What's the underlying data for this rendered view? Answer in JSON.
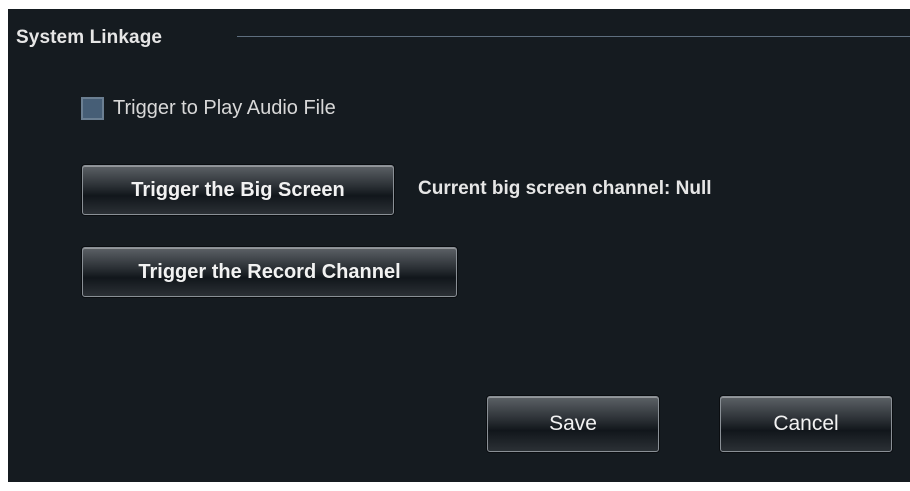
{
  "section": {
    "title": "System Linkage"
  },
  "audio_checkbox": {
    "label": "Trigger to Play Audio File",
    "checked": false
  },
  "buttons": {
    "big_screen": "Trigger the Big Screen",
    "record_channel": "Trigger the Record Channel",
    "save": "Save",
    "cancel": "Cancel"
  },
  "status": {
    "big_screen_channel": "Current big screen channel: Null"
  },
  "colors": {
    "panel_background": "#151b20",
    "checkbox_fill": "#465e76",
    "text": "#e6e6e6"
  }
}
